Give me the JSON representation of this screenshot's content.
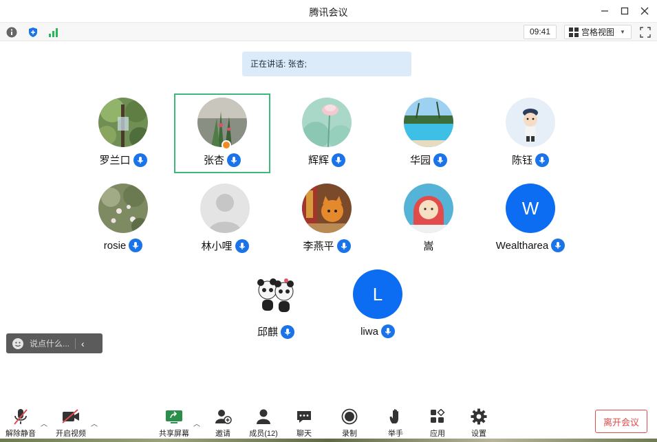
{
  "window": {
    "title": "腾讯会议"
  },
  "toolbar": {
    "time": "09:41",
    "view_label": "宫格视图"
  },
  "speaking": {
    "text": "正在讲话: 张杏;"
  },
  "participants": [
    {
      "name": "罗兰口",
      "avatar": "forest-photo",
      "mic": "on"
    },
    {
      "name": "张杏",
      "avatar": "plant-photo",
      "mic": "on",
      "host": true,
      "active": true
    },
    {
      "name": "辉辉",
      "avatar": "flower-photo",
      "mic": "on"
    },
    {
      "name": "华园",
      "avatar": "pool-photo",
      "mic": "on"
    },
    {
      "name": "陈钰",
      "avatar": "cartoon-boy",
      "mic": "on"
    },
    {
      "name": "rosie",
      "avatar": "blossom-photo",
      "mic": "on"
    },
    {
      "name": "林小哩",
      "avatar": "default-person",
      "mic": "on"
    },
    {
      "name": "李燕平",
      "avatar": "cat-photo",
      "mic": "on"
    },
    {
      "name": "嵩",
      "avatar": "cartoon-girl",
      "mic": "none"
    },
    {
      "name": "Wealtharea",
      "avatar_letter": "W",
      "mic": "on"
    },
    {
      "name": "邱麒",
      "avatar": "panda-cartoon",
      "mic": "on"
    },
    {
      "name": "liwa",
      "avatar_letter": "L",
      "mic": "on"
    }
  ],
  "chat": {
    "placeholder": "说点什么..."
  },
  "bottom": {
    "unmute": "解除静音",
    "video": "开启视频",
    "share": "共享屏幕",
    "invite": "邀请",
    "members": "成员(12)",
    "chat": "聊天",
    "record": "录制",
    "raise_hand": "举手",
    "apps": "应用",
    "settings": "设置",
    "leave": "离开会议"
  },
  "colors": {
    "accent": "#1a73e8",
    "active_border": "#3cb878",
    "leave": "#e14b4b",
    "banner": "#dcebfa"
  }
}
